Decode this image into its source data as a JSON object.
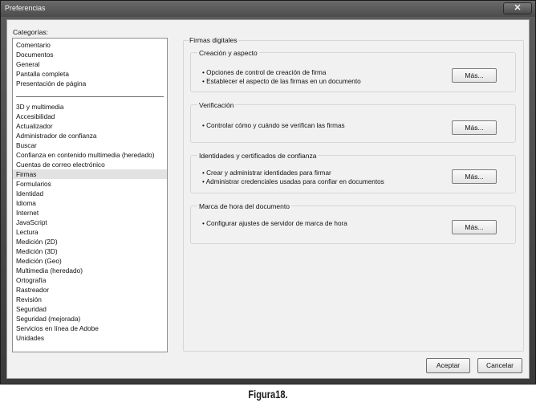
{
  "window": {
    "title": "Preferencias",
    "close_symbol": "✕"
  },
  "sidebar": {
    "label": "Categorías:",
    "group1": [
      {
        "label": "Comentario"
      },
      {
        "label": "Documentos"
      },
      {
        "label": "General"
      },
      {
        "label": "Pantalla completa"
      },
      {
        "label": "Presentación de página"
      }
    ],
    "group2": [
      {
        "label": "3D y multimedia"
      },
      {
        "label": "Accesibilidad"
      },
      {
        "label": "Actualizador"
      },
      {
        "label": "Administrador de confianza"
      },
      {
        "label": "Buscar"
      },
      {
        "label": "Confianza en contenido multimedia (heredado)"
      },
      {
        "label": "Cuentas de correo electrónico"
      },
      {
        "label": "Firmas",
        "selected": true
      },
      {
        "label": "Formularios"
      },
      {
        "label": "Identidad"
      },
      {
        "label": "Idioma"
      },
      {
        "label": "Internet"
      },
      {
        "label": "JavaScript"
      },
      {
        "label": "Lectura"
      },
      {
        "label": "Medición (2D)"
      },
      {
        "label": "Medición (3D)"
      },
      {
        "label": "Medición (Geo)"
      },
      {
        "label": "Multimedia (heredado)"
      },
      {
        "label": "Ortografía"
      },
      {
        "label": "Rastreador"
      },
      {
        "label": "Revisión"
      },
      {
        "label": "Seguridad"
      },
      {
        "label": "Seguridad (mejorada)"
      },
      {
        "label": "Servicios en línea de Adobe"
      },
      {
        "label": "Unidades"
      }
    ]
  },
  "main": {
    "title": "Firmas digitales",
    "sections": [
      {
        "title": "Creación y aspecto",
        "bullets": [
          "• Opciones de control de creación de firma",
          "• Establecer el aspecto de las firmas en un documento"
        ],
        "button": "Más..."
      },
      {
        "title": "Verificación",
        "bullets": [
          "• Controlar cómo y cuándo se verifican las firmas"
        ],
        "button": "Más..."
      },
      {
        "title": "Identidades y certificados de confianza",
        "bullets": [
          "• Crear y administrar identidades para firmar",
          "• Administrar credenciales usadas para confiar en documentos"
        ],
        "button": "Más..."
      },
      {
        "title": "Marca de hora del documento",
        "bullets": [
          "• Configurar ajustes de servidor de marca de hora"
        ],
        "button": "Más..."
      }
    ]
  },
  "footer": {
    "ok_label": "Aceptar",
    "cancel_label": "Cancelar"
  },
  "caption": "Figura18."
}
